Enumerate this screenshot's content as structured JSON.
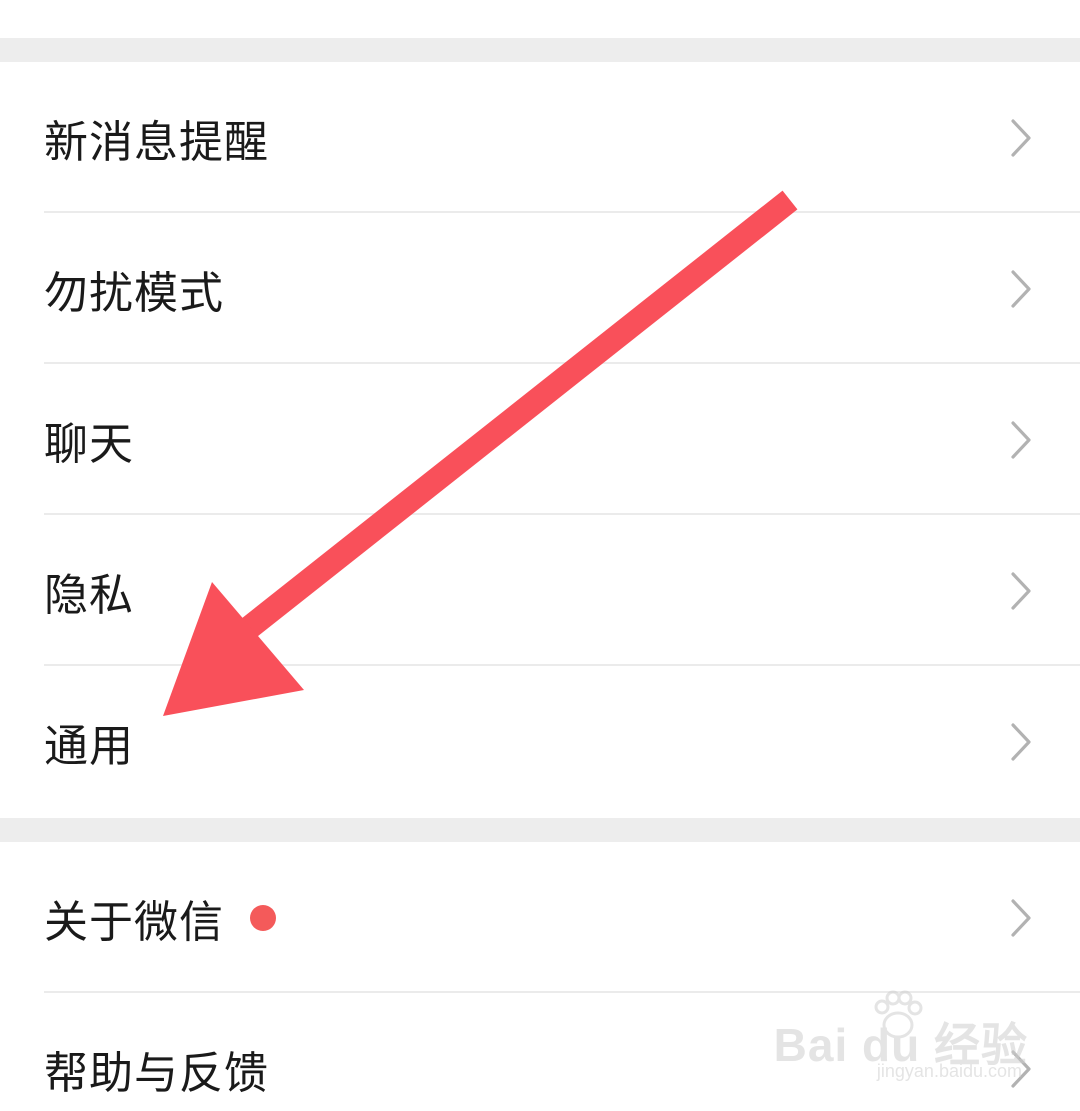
{
  "settings": {
    "group1": [
      {
        "label": "新消息提醒"
      },
      {
        "label": "勿扰模式"
      },
      {
        "label": "聊天"
      },
      {
        "label": "隐私"
      },
      {
        "label": "通用"
      }
    ],
    "group2": [
      {
        "label": "关于微信",
        "badge": "red-dot"
      },
      {
        "label": "帮助与反馈"
      }
    ]
  },
  "icons": {
    "row_chevron": "chevron-right-icon",
    "annotation": "red-arrow-annotation"
  },
  "colors": {
    "background": "#ffffff",
    "section_gap": "#ededed",
    "divider": "#ebebeb",
    "text": "#1a1a1a",
    "chevron": "#b2b2b2",
    "badge": "#f45a5a",
    "arrow": "#f9505a"
  },
  "watermark": {
    "brand": "Bai du 经验",
    "url": "jingyan.baidu.com"
  }
}
